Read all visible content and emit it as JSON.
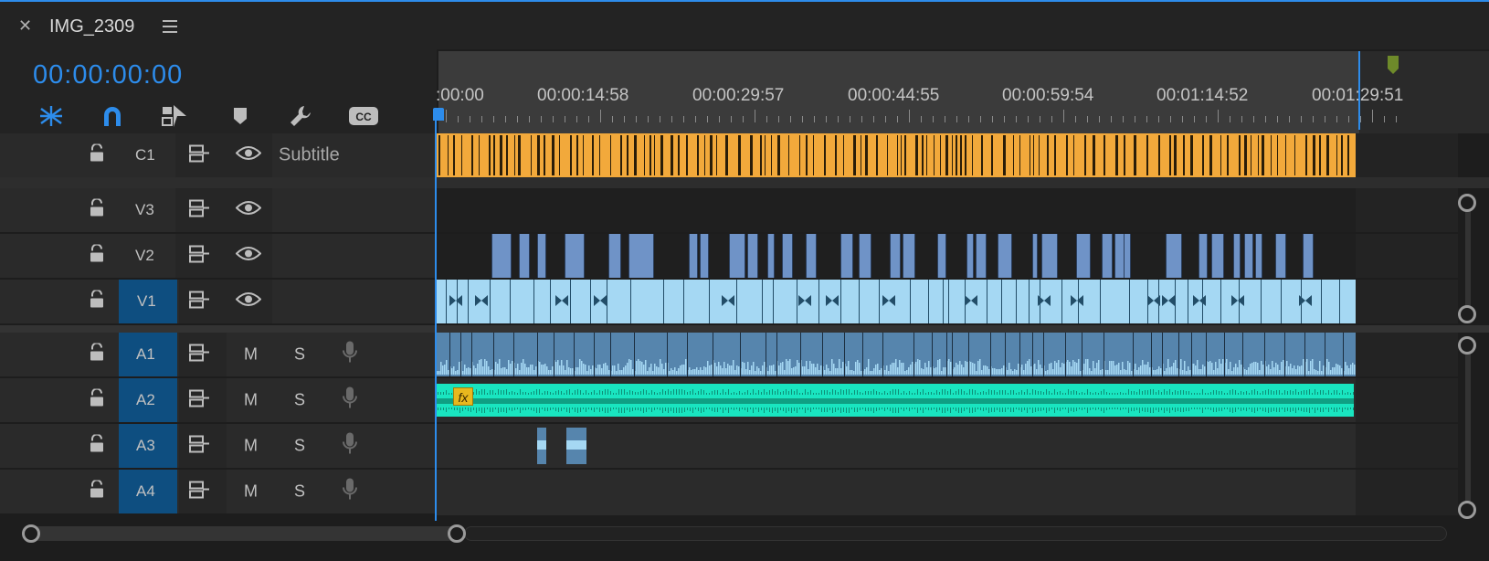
{
  "panel": {
    "title": "IMG_2309",
    "timecode": "00:00:00:00",
    "accent": "#2d8ceb"
  },
  "tools": [
    {
      "name": "snap-in-timeline-icon"
    },
    {
      "name": "magnet-icon"
    },
    {
      "name": "linked-selection-icon"
    },
    {
      "name": "add-marker-icon"
    },
    {
      "name": "wrench-settings-icon"
    },
    {
      "name": "closed-captions-icon",
      "label": "CC"
    }
  ],
  "ruler": {
    "labels": [
      ":00:00",
      "00:00:14:58",
      "00:00:29:57",
      "00:00:44:55",
      "00:00:59:54",
      "00:01:14:52",
      "00:01:29:51"
    ]
  },
  "tracks": {
    "caption": {
      "id": "C1",
      "name": "Subtitle"
    },
    "video": [
      {
        "id": "V3",
        "selected": false
      },
      {
        "id": "V2",
        "selected": false
      },
      {
        "id": "V1",
        "selected": true
      }
    ],
    "audio": [
      {
        "id": "A1",
        "mute": "M",
        "solo": "S"
      },
      {
        "id": "A2",
        "mute": "M",
        "solo": "S"
      },
      {
        "id": "A3",
        "mute": "M",
        "solo": "S"
      },
      {
        "id": "A4",
        "mute": "M",
        "solo": "S"
      }
    ]
  },
  "effects_badge": "fx",
  "colors": {
    "caption_clip": "#f2a93b",
    "v2_clip": "#6f93c7",
    "v1_clip": "#a5d8f3",
    "a1_clip": "#5685ad",
    "a2_clip": "#19e5c0",
    "selected_header": "#0e4e80"
  }
}
